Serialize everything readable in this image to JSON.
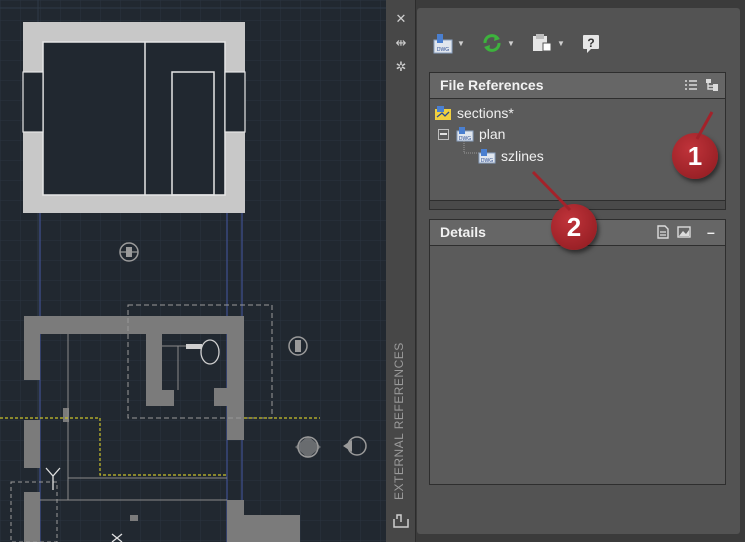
{
  "palette": {
    "vertical_title": "EXTERNAL REFERENCES",
    "strip_buttons": [
      {
        "icon": "close-icon",
        "glyph": "✕"
      },
      {
        "icon": "auto-hide-icon",
        "glyph": "⇹"
      },
      {
        "icon": "properties-icon",
        "glyph": "✲"
      }
    ],
    "toolbar": [
      {
        "icon": "attach-dwg-icon"
      },
      {
        "icon": "refresh-icon"
      },
      {
        "icon": "change-path-icon"
      },
      {
        "icon": "help-icon"
      }
    ]
  },
  "file_references": {
    "header": "File References",
    "list_view_icon": "list-view-icon",
    "tree_view_icon": "tree-view-icon",
    "items": [
      {
        "label": "sections*",
        "icon": "drawing-icon"
      },
      {
        "label": "plan",
        "icon": "dwg-icon",
        "expanded": true
      },
      {
        "label": "szlines",
        "icon": "dwg-icon"
      }
    ]
  },
  "details": {
    "header": "Details",
    "details_icon": "details-icon",
    "preview_icon": "preview-icon",
    "collapse_glyph": "–"
  },
  "callouts": [
    "1",
    "2"
  ],
  "colors": {
    "callout": "#a3222a",
    "panel": "#535353",
    "canvas": "#212830"
  }
}
